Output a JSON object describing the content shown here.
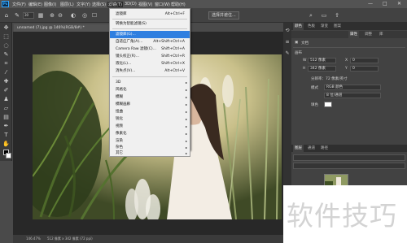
{
  "menubar": {
    "logo": "Ps",
    "items": [
      "文件(F)",
      "编辑(E)",
      "图像(I)",
      "图层(L)",
      "文字(Y)",
      "选择(S)",
      "滤镜(T)",
      "3D(D)",
      "视图(V)",
      "窗口(W)",
      "帮助(H)"
    ],
    "window_controls": [
      "—",
      "□",
      "✕"
    ]
  },
  "optbar": {
    "brush_size": "30",
    "mode_label": "模式：",
    "mode_value": "正常",
    "opacity_label": "不透明度：",
    "opacity_value": "100%",
    "flow_label": "流量：",
    "flow_value": "100%",
    "select_button": "选择并遮住..."
  },
  "doc_tab": "unnamed (7).jpg @ 146%(RGB/8#) *",
  "filter_menu": {
    "items": [
      {
        "label": "滤镜库",
        "shortcut": "Alt+Ctrl+F"
      },
      {
        "label": "转换为智能滤镜(S)",
        "shortcut": ""
      },
      {
        "label": "滤镜库(G)...",
        "shortcut": ""
      },
      {
        "label": "自适应广角(A)...",
        "shortcut": "Alt+Shift+Ctrl+A"
      },
      {
        "label": "Camera Raw 滤镜(C)...",
        "shortcut": "Shift+Ctrl+A"
      },
      {
        "label": "镜头校正(R)...",
        "shortcut": "Shift+Ctrl+R"
      },
      {
        "label": "液化(L)...",
        "shortcut": "Shift+Ctrl+X"
      },
      {
        "label": "消失点(V)...",
        "shortcut": "Alt+Ctrl+V"
      },
      {
        "label": "3D",
        "shortcut": ""
      },
      {
        "label": "风格化",
        "shortcut": ""
      },
      {
        "label": "模糊",
        "shortcut": ""
      },
      {
        "label": "模糊画廊",
        "shortcut": ""
      },
      {
        "label": "扭曲",
        "shortcut": ""
      },
      {
        "label": "锐化",
        "shortcut": ""
      },
      {
        "label": "视频",
        "shortcut": ""
      },
      {
        "label": "像素化",
        "shortcut": ""
      },
      {
        "label": "渲染",
        "shortcut": ""
      },
      {
        "label": "杂色",
        "shortcut": ""
      },
      {
        "label": "其它",
        "shortcut": ""
      }
    ],
    "arrow": "▸"
  },
  "right_panel": {
    "top_tabs": [
      "颜色",
      "色板",
      "渐变",
      "图案"
    ],
    "props_tabs": [
      "属性",
      "调整",
      "库"
    ],
    "doc_label": "文档",
    "canvas_header": "画布",
    "w_label": "W",
    "w_value": "512 像素",
    "h_label": "H",
    "h_value": "342 像素",
    "x_label": "X",
    "x_value": "0",
    "y_label": "Y",
    "y_value": "0",
    "resolution": "分辨率：72 像素/英寸",
    "mode_label": "模式",
    "mode_value": "RGB 颜色",
    "depth_value": "8 位/通道",
    "fill_label": "填色",
    "layers_tabs": [
      "图层",
      "通道",
      "路径"
    ]
  },
  "statusbar": {
    "zoom": "146.47%",
    "dimensions": "512 像素 x 342 像素 (72 ppi)"
  },
  "watermark": "软件技巧"
}
